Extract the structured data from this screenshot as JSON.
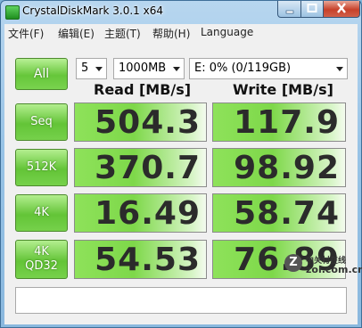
{
  "window": {
    "title": "CrystalDiskMark 3.0.1 x64"
  },
  "menu": [
    {
      "label": "文件(F)"
    },
    {
      "label": "编辑(E)"
    },
    {
      "label": "主题(T)"
    },
    {
      "label": "帮助(H)"
    },
    {
      "label": "Language"
    }
  ],
  "controls": {
    "all_label": "All",
    "count_value": "5",
    "size_value": "1000MB",
    "drive_value": "E: 0% (0/119GB)"
  },
  "columns": {
    "read": "Read [MB/s]",
    "write": "Write [MB/s]"
  },
  "rows": [
    {
      "label_lines": [
        "Seq"
      ],
      "read": "504.3",
      "write": "117.9"
    },
    {
      "label_lines": [
        "512K"
      ],
      "read": "370.7",
      "write": "98.92"
    },
    {
      "label_lines": [
        "4K"
      ],
      "read": "16.49",
      "write": "58.74"
    },
    {
      "label_lines": [
        "4K",
        "QD32"
      ],
      "read": "54.53",
      "write": "76.89"
    }
  ],
  "status": {
    "text": ""
  },
  "watermark": {
    "line1": "中关村在线",
    "line2": "zol.com.cn",
    "logo": "Z"
  },
  "colors": {
    "accent_green": "#66c63a",
    "title_bar": "#98c3e6",
    "close_button": "#c7412a"
  }
}
